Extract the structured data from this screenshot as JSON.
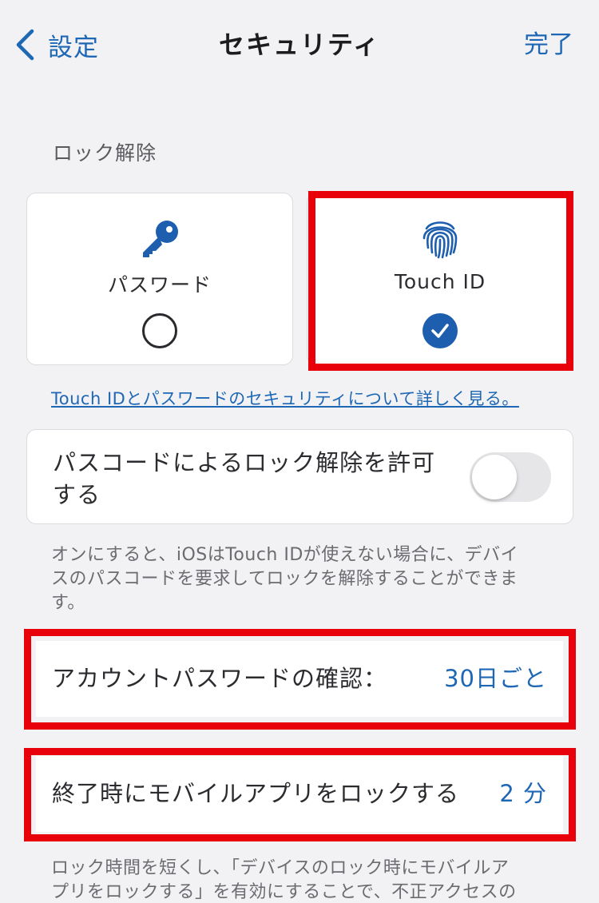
{
  "nav": {
    "back_label": "設定",
    "title": "セキュリティ",
    "done_label": "完了"
  },
  "unlock": {
    "section_label": "ロック解除",
    "options": [
      {
        "label": "パスワード",
        "icon": "key-icon",
        "selected": false
      },
      {
        "label": "Touch ID",
        "icon": "fingerprint-icon",
        "selected": true
      }
    ],
    "learn_more": "Touch IDとパスワードのセキュリティについて詳しく見る。"
  },
  "passcode": {
    "line1": "パスコードによるロック解除を許可",
    "line2": "する",
    "enabled": false,
    "footnote_lines": [
      "オンにすると、iOSはTouch IDが使えない場合に、デバイ",
      "スのパスコードを要求してロックを解除することができま",
      "す。"
    ]
  },
  "settings": {
    "account_confirm": {
      "label": "アカウントパスワードの確認：",
      "value": "30日ごと"
    },
    "lock_on_exit": {
      "label": "終了時にモバイルアプリをロックする",
      "value": "2 分"
    },
    "footnote_lines": [
      "ロック時間を短くし、「デバイスのロック時にモバイルア",
      "プリをロックする」を有効にすることで、不正アクセスの"
    ]
  },
  "colors": {
    "accent": "#1d67b5",
    "highlight": "#e8000b",
    "background": "#f2f2f4"
  }
}
